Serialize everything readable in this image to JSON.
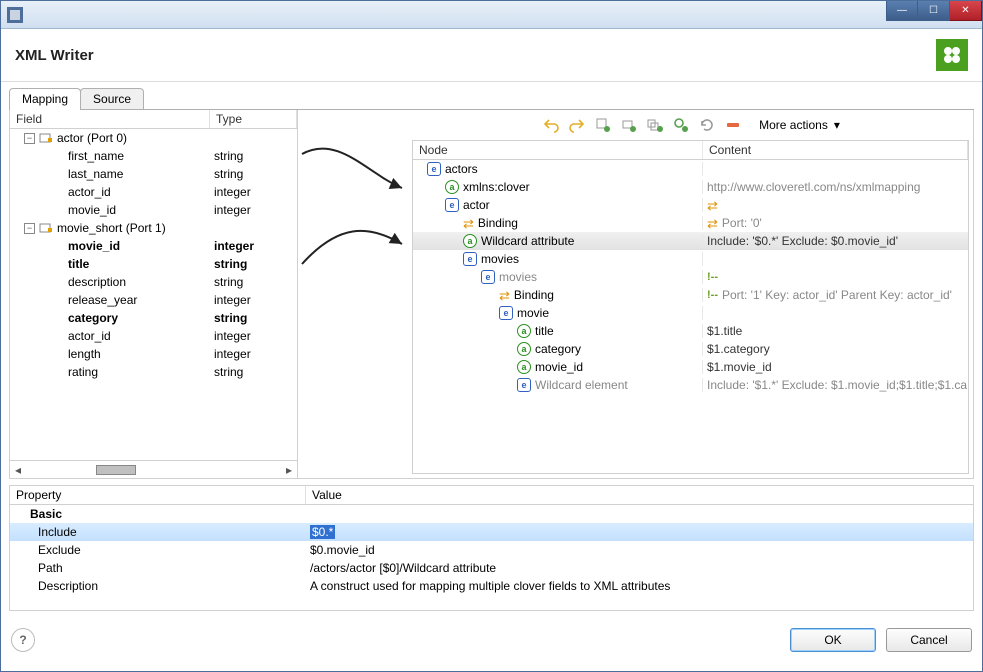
{
  "title": "XML Writer",
  "tabs": {
    "mapping": "Mapping",
    "source": "Source"
  },
  "left": {
    "headerField": "Field",
    "headerType": "Type",
    "rows": [
      {
        "ind": 0,
        "kind": "port",
        "label": "actor (Port 0)",
        "type": "",
        "bold": false
      },
      {
        "ind": 1,
        "kind": "field",
        "label": "first_name",
        "type": "string",
        "bold": false
      },
      {
        "ind": 1,
        "kind": "field",
        "label": "last_name",
        "type": "string",
        "bold": false
      },
      {
        "ind": 1,
        "kind": "field",
        "label": "actor_id",
        "type": "integer",
        "bold": false
      },
      {
        "ind": 1,
        "kind": "field",
        "label": "movie_id",
        "type": "integer",
        "bold": false
      },
      {
        "ind": 0,
        "kind": "port",
        "label": "movie_short (Port 1)",
        "type": "",
        "bold": false
      },
      {
        "ind": 1,
        "kind": "field",
        "label": "movie_id",
        "type": "integer",
        "bold": true
      },
      {
        "ind": 1,
        "kind": "field",
        "label": "title",
        "type": "string",
        "bold": true
      },
      {
        "ind": 1,
        "kind": "field",
        "label": "description",
        "type": "string",
        "bold": false
      },
      {
        "ind": 1,
        "kind": "field",
        "label": "release_year",
        "type": "integer",
        "bold": false
      },
      {
        "ind": 1,
        "kind": "field",
        "label": "category",
        "type": "string",
        "bold": true
      },
      {
        "ind": 1,
        "kind": "field",
        "label": "actor_id",
        "type": "integer",
        "bold": false
      },
      {
        "ind": 1,
        "kind": "field",
        "label": "length",
        "type": "integer",
        "bold": false
      },
      {
        "ind": 1,
        "kind": "field",
        "label": "rating",
        "type": "string",
        "bold": false
      }
    ]
  },
  "toolbar": {
    "more": "More actions"
  },
  "right": {
    "headerNode": "Node",
    "headerContent": "Content",
    "rows": [
      {
        "ind": 0,
        "icon": "e",
        "label": "actors",
        "content": "",
        "grey": false,
        "sel": false,
        "cicon": ""
      },
      {
        "ind": 1,
        "icon": "a",
        "label": "xmlns:clover",
        "content": "http://www.cloveretl.com/ns/xmlmapping",
        "grey": true,
        "sel": false,
        "cicon": ""
      },
      {
        "ind": 1,
        "icon": "e",
        "label": "actor",
        "content": "",
        "grey": false,
        "sel": false,
        "cicon": "bind"
      },
      {
        "ind": 2,
        "icon": "bind",
        "label": "Binding",
        "content": "Port: '0'",
        "grey": true,
        "sel": false,
        "cicon": "bind"
      },
      {
        "ind": 2,
        "icon": "a",
        "label": "Wildcard attribute",
        "content": "Include: '$0.*' Exclude: $0.movie_id'",
        "grey": false,
        "sel": true,
        "cicon": ""
      },
      {
        "ind": 2,
        "icon": "e",
        "label": "movies",
        "content": "",
        "grey": false,
        "sel": false,
        "cicon": ""
      },
      {
        "ind": 3,
        "icon": "e",
        "label": "movies",
        "content": "",
        "grey": true,
        "sel": false,
        "cicon": "mark",
        "lgrey": true
      },
      {
        "ind": 4,
        "icon": "bind",
        "label": "Binding",
        "content": "Port: '1' Key: actor_id' Parent Key: actor_id'",
        "grey": true,
        "sel": false,
        "cicon": "mark"
      },
      {
        "ind": 4,
        "icon": "e",
        "label": "movie",
        "content": "",
        "grey": false,
        "sel": false,
        "cicon": ""
      },
      {
        "ind": 5,
        "icon": "a",
        "label": "title",
        "content": "$1.title",
        "grey": false,
        "sel": false,
        "cicon": ""
      },
      {
        "ind": 5,
        "icon": "a",
        "label": "category",
        "content": "$1.category",
        "grey": false,
        "sel": false,
        "cicon": ""
      },
      {
        "ind": 5,
        "icon": "a",
        "label": "movie_id",
        "content": "$1.movie_id",
        "grey": false,
        "sel": false,
        "cicon": ""
      },
      {
        "ind": 5,
        "icon": "e",
        "label": "Wildcard element",
        "content": "Include: '$1.*' Exclude: $1.movie_id;$1.title;$1.ca...",
        "grey": true,
        "sel": false,
        "cicon": "",
        "lgrey": true
      }
    ]
  },
  "props": {
    "headerProp": "Property",
    "headerVal": "Value",
    "section": "Basic",
    "rows": [
      {
        "name": "Include",
        "value": "$0.*",
        "sel": true
      },
      {
        "name": "Exclude",
        "value": "$0.movie_id",
        "sel": false
      },
      {
        "name": "Path",
        "value": "/actors/actor [$0]/Wildcard attribute",
        "sel": false
      },
      {
        "name": "Description",
        "value": "A construct used for mapping multiple clover fields to XML attributes",
        "sel": false
      }
    ]
  },
  "buttons": {
    "ok": "OK",
    "cancel": "Cancel"
  }
}
